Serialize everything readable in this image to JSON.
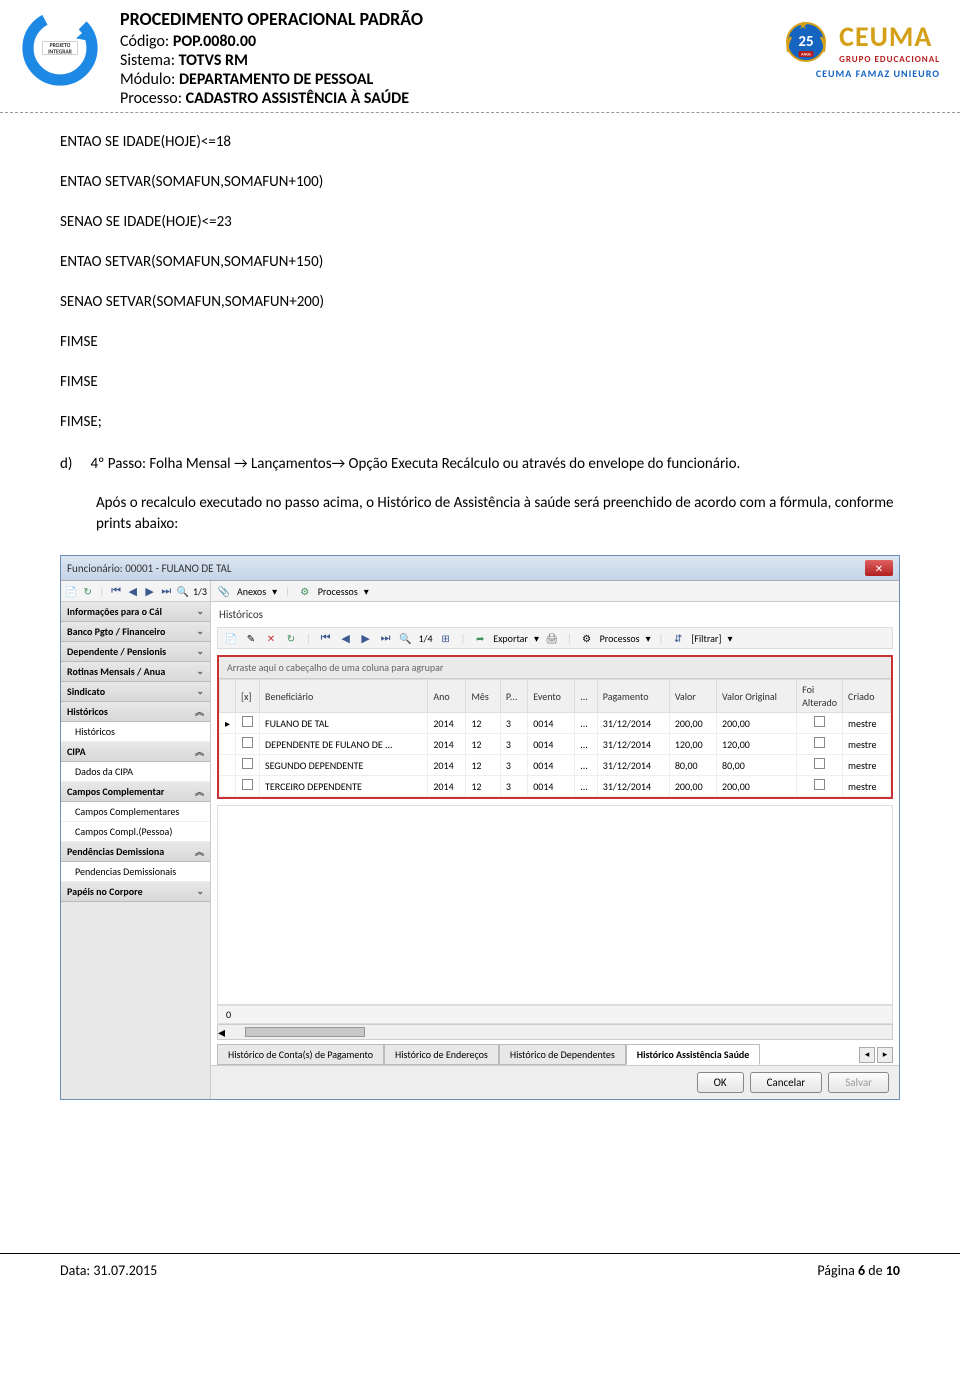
{
  "header": {
    "title": "PROCEDIMENTO OPERACIONAL PADRÃO",
    "codigo_label": "Código: ",
    "codigo_value": "POP.0080.00",
    "sistema_label": "Sistema: ",
    "sistema_value": "TOTVS RM",
    "modulo_label": "Módulo: ",
    "modulo_value": "DEPARTAMENTO DE PESSOAL",
    "processo_label": "Processo: ",
    "processo_value": "CADASTRO ASSISTÊNCIA À SAÚDE",
    "logo_integrar_text": "PROJETO INTEGRAR",
    "ceuma_main": "CEUMA",
    "ceuma_sub1": "GRUPO EDUCACIONAL",
    "ceuma_sub2": "CEUMA FAMAZ UNIEURO",
    "anniversary": "25",
    "anniversary_label": "ANOS"
  },
  "code": {
    "line1": "ENTAO SE IDADE(HOJE)<=18",
    "line2": "ENTAO SETVAR(SOMAFUN,SOMAFUN+100)",
    "line3": "SENAO SE IDADE(HOJE)<=23",
    "line4": "ENTAO SETVAR(SOMAFUN,SOMAFUN+150)",
    "line5": "SENAO SETVAR(SOMAFUN,SOMAFUN+200)",
    "line6": "FIMSE",
    "line7": "FIMSE",
    "line8": "FIMSE;"
  },
  "step": {
    "letter": "d)",
    "text": "4º Passo: Folha Mensal → Lançamentos→ Opção Executa Recálculo ou através do envelope do funcionário."
  },
  "note": "Após o recalculo executado no passo acima, o Histórico de Assistência à saúde será preenchido de acordo com a fórmula, conforme prints abaixo:",
  "screenshot": {
    "title": "Funcionário: 00001 - FULANO DE TAL",
    "toolbar_main": {
      "nav_count": "1/3",
      "anexos": "Anexos",
      "processos": "Processos"
    },
    "sidebar": {
      "groups": [
        {
          "label": "Informações para o Cál",
          "items": []
        },
        {
          "label": "Banco Pgto / Financeiro",
          "items": []
        },
        {
          "label": "Dependente / Pensionis",
          "items": []
        },
        {
          "label": "Rotinas Mensais / Anua",
          "items": []
        },
        {
          "label": "Sindicato",
          "items": []
        },
        {
          "label": "Históricos",
          "items": [
            "Históricos"
          ]
        },
        {
          "label": "CIPA",
          "items": [
            "Dados da CIPA"
          ]
        },
        {
          "label": "Campos Complementar",
          "items": [
            "Campos Complementares",
            "Campos Compl.(Pessoa)"
          ]
        },
        {
          "label": "Pendências Demissiona",
          "items": [
            "Pendencias Demissionais"
          ]
        },
        {
          "label": "Papéis no Corpore",
          "items": []
        }
      ]
    },
    "panel_label": "Históricos",
    "sub_toolbar": {
      "nav_count": "1/4",
      "exportar": "Exportar",
      "processos": "Processos",
      "filtrar": "[Filtrar]"
    },
    "group_text": "Arraste aqui o cabeçalho de uma coluna para agrupar",
    "columns": [
      "[x]",
      "Beneficiário",
      "Ano",
      "Mês",
      "P...",
      "Evento",
      "...",
      "Pagamento",
      "Valor",
      "Valor Original",
      "Foi Alterado",
      "Criado"
    ],
    "rows": [
      {
        "indicator": "▸",
        "sel": false,
        "beneficiario": "FULANO DE TAL",
        "ano": "2014",
        "mes": "12",
        "p": "3",
        "evento": "0014",
        "dots": "...",
        "pagamento": "31/12/2014",
        "valor": "200,00",
        "valor_original": "200,00",
        "alterado": false,
        "criado": "mestre"
      },
      {
        "indicator": "",
        "sel": false,
        "beneficiario": "DEPENDENTE DE FULANO DE ...",
        "ano": "2014",
        "mes": "12",
        "p": "3",
        "evento": "0014",
        "dots": "...",
        "pagamento": "31/12/2014",
        "valor": "120,00",
        "valor_original": "120,00",
        "alterado": false,
        "criado": "mestre"
      },
      {
        "indicator": "",
        "sel": false,
        "beneficiario": "SEGUNDO DEPENDENTE",
        "ano": "2014",
        "mes": "12",
        "p": "3",
        "evento": "0014",
        "dots": "...",
        "pagamento": "31/12/2014",
        "valor": "80,00",
        "valor_original": "80,00",
        "alterado": false,
        "criado": "mestre"
      },
      {
        "indicator": "",
        "sel": false,
        "beneficiario": "TERCEIRO DEPENDENTE",
        "ano": "2014",
        "mes": "12",
        "p": "3",
        "evento": "0014",
        "dots": "...",
        "pagamento": "31/12/2014",
        "valor": "200,00",
        "valor_original": "200,00",
        "alterado": false,
        "criado": "mestre"
      }
    ],
    "count": "0",
    "tabs": [
      "Histórico de Conta(s) de Pagamento",
      "Histórico de Endereços",
      "Histórico de Dependentes",
      "Histórico Assistência Saúde"
    ],
    "active_tab": 3,
    "buttons": {
      "ok": "OK",
      "cancelar": "Cancelar",
      "salvar": "Salvar"
    }
  },
  "footer": {
    "data_label": "Data: ",
    "data_value": "31.07.2015",
    "page_prefix": "Página ",
    "page_current": "6",
    "page_sep": " de ",
    "page_total": "10"
  }
}
